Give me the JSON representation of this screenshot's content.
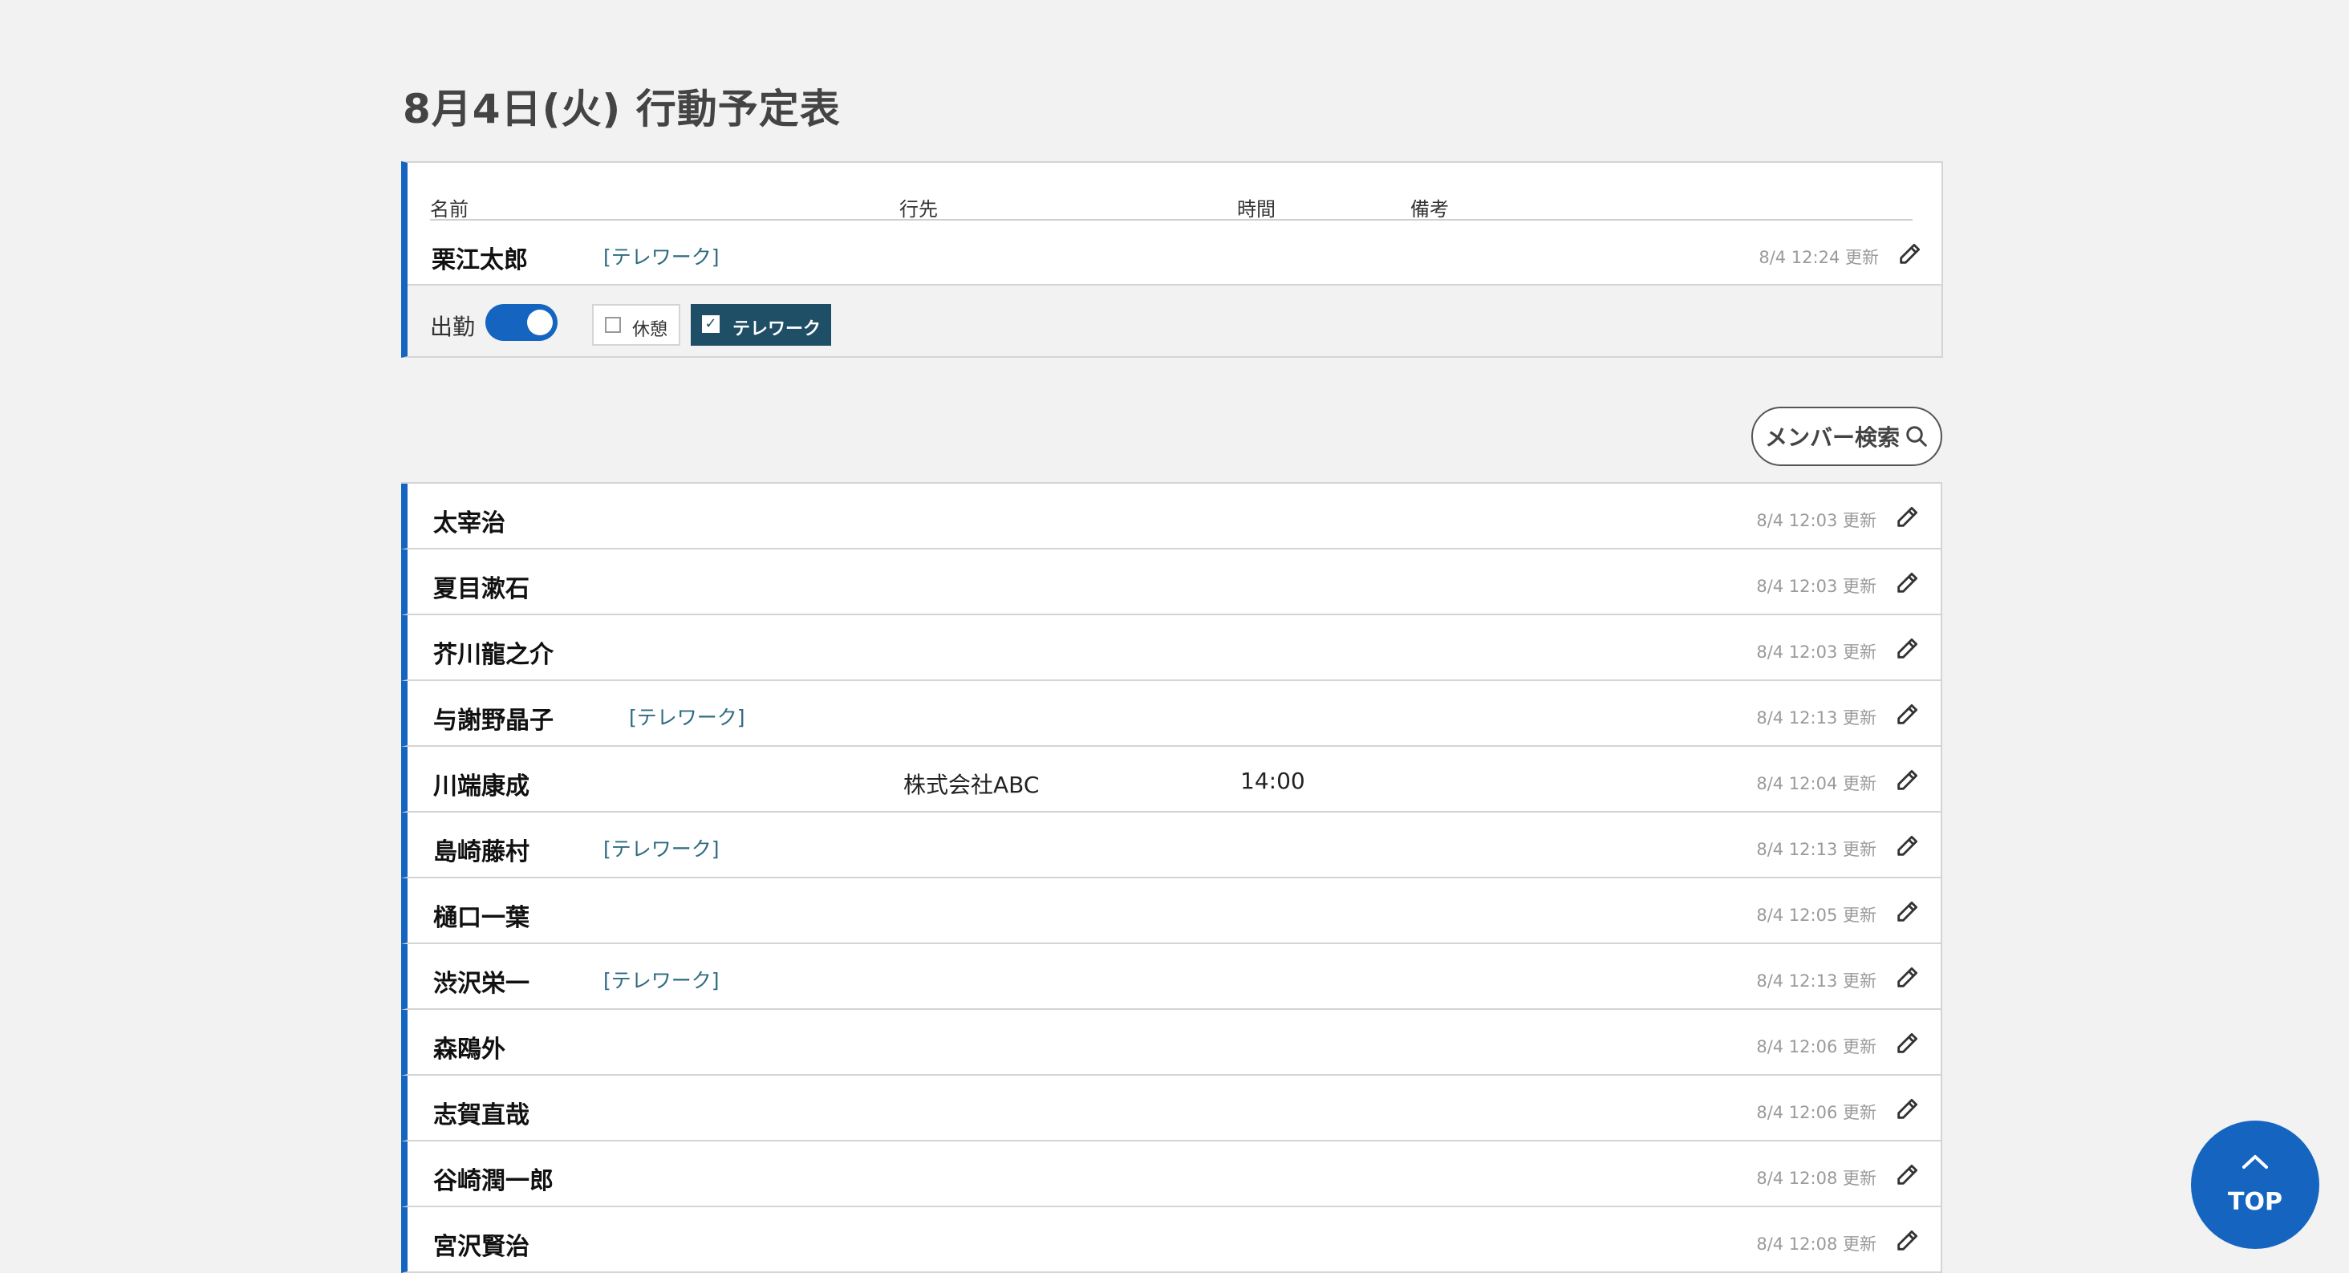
{
  "page": {
    "title": "8月4日(火) 行動予定表"
  },
  "columns": {
    "name": "名前",
    "destination": "行先",
    "time": "時間",
    "note": "備考"
  },
  "self": {
    "name": "栗江太郎",
    "tag": "[テレワーク]",
    "updated": "8/4 12:24 更新",
    "attend_label": "出勤",
    "attend_on": true,
    "break_label": "休憩",
    "break_checked": false,
    "telework_label": "テレワーク",
    "telework_checked": true
  },
  "search": {
    "label": "メンバー検索"
  },
  "members": [
    {
      "name": "太宰治",
      "tag": "",
      "destination": "",
      "time": "",
      "updated": "8/4 12:03 更新"
    },
    {
      "name": "夏目漱石",
      "tag": "",
      "destination": "",
      "time": "",
      "updated": "8/4 12:03 更新"
    },
    {
      "name": "芥川龍之介",
      "tag": "",
      "destination": "",
      "time": "",
      "updated": "8/4 12:03 更新"
    },
    {
      "name": "与謝野晶子",
      "tag": "[テレワーク]",
      "destination": "",
      "time": "",
      "updated": "8/4 12:13 更新"
    },
    {
      "name": "川端康成",
      "tag": "",
      "destination": "株式会社ABC",
      "time": "14:00",
      "updated": "8/4 12:04 更新"
    },
    {
      "name": "島崎藤村",
      "tag": "[テレワーク]",
      "destination": "",
      "time": "",
      "updated": "8/4 12:13 更新"
    },
    {
      "name": "樋口一葉",
      "tag": "",
      "destination": "",
      "time": "",
      "updated": "8/4 12:05 更新"
    },
    {
      "name": "渋沢栄一",
      "tag": "[テレワーク]",
      "destination": "",
      "time": "",
      "updated": "8/4 12:13 更新"
    },
    {
      "name": "森鴎外",
      "tag": "",
      "destination": "",
      "time": "",
      "updated": "8/4 12:06 更新"
    },
    {
      "name": "志賀直哉",
      "tag": "",
      "destination": "",
      "time": "",
      "updated": "8/4 12:06 更新"
    },
    {
      "name": "谷崎潤一郎",
      "tag": "",
      "destination": "",
      "time": "",
      "updated": "8/4 12:08 更新"
    },
    {
      "name": "宮沢賢治",
      "tag": "",
      "destination": "",
      "time": "",
      "updated": "8/4 12:08 更新"
    }
  ],
  "top_button": {
    "label": "TOP"
  },
  "colors": {
    "accent": "#1565c0",
    "chip_dark": "#1f4e67",
    "tag_text": "#2f6a82",
    "background": "#f2f2f2"
  }
}
